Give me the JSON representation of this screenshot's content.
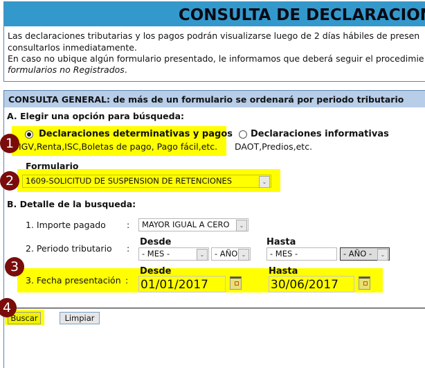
{
  "header": {
    "title": "CONSULTA DE DECLARACION",
    "intro_lines": [
      "Las declaraciones tributarias y los pagos podrán visualizarse luego de 2 días hábiles de presen",
      "consultarlos inmediatamente.",
      "En caso no ubique algún formulario presentado, le informamos que deberá seguir el procedimie"
    ],
    "intro_italic": "formularios no Registrados",
    "intro_end": "."
  },
  "section": {
    "title": "CONSULTA GENERAL: de más de un formulario se ordenará por periodo tributario",
    "a_label": "A. Elegir una opción para búsqueda:",
    "option1": {
      "label": "Declaraciones determinativas y pagos",
      "sub": "IGV,Renta,ISC,Boletas de pago, Pago fácil,etc.",
      "selected": true
    },
    "option2": {
      "label": "Declaraciones informativas",
      "sub": "DAOT,Predios,etc.",
      "selected": false
    },
    "formulario_label": "Formulario",
    "formulario_value": "1609-SOLICITUD DE SUSPENSION DE RETENCIONES",
    "b_label": "B. Detalle de la busqueda:",
    "importe_label": "1. Importe pagado",
    "importe_value": "MAYOR IGUAL A CERO",
    "periodo_label": "2. Periodo tributario",
    "colon": ":",
    "desde": "Desde",
    "hasta": "Hasta",
    "mes": "- MES -",
    "anio": "- AÑO -",
    "fecha_label": "3. Fecha presentación",
    "fecha_desde": "01/01/2017",
    "fecha_hasta": "30/06/2017",
    "buscar": "Buscar",
    "limpiar": "Limpiar"
  },
  "badges": [
    "1",
    "2",
    "3",
    "4"
  ],
  "colors": {
    "header_blue": "#3399cc",
    "section_blue": "#b7cde8",
    "highlight": "#ffff00",
    "badge": "#7a0c0c"
  }
}
